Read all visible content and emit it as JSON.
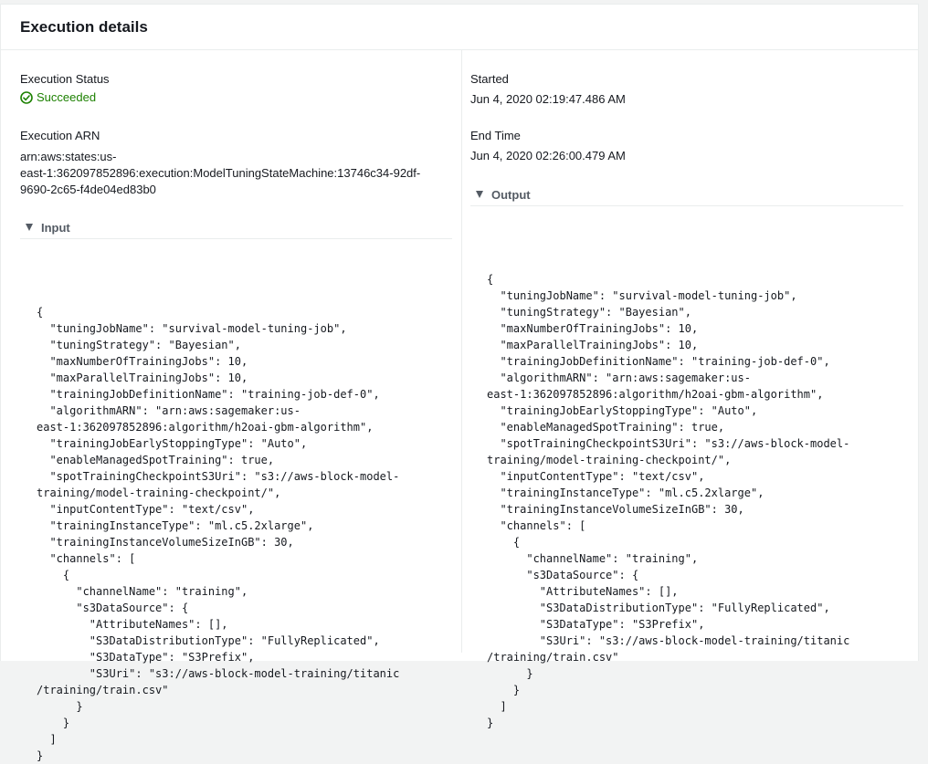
{
  "panel": {
    "title": "Execution details"
  },
  "left": {
    "status_label": "Execution Status",
    "status_value": "Succeeded",
    "arn_label": "Execution ARN",
    "arn_lines": [
      "arn:aws:states:us-",
      "east-1:362097852896:execution:ModelTuningStateMachine:13746c34-92df-",
      "9690-2c65-f4de04ed83b0"
    ],
    "input_label": "Input",
    "input_json": "{\n  \"tuningJobName\": \"survival-model-tuning-job\",\n  \"tuningStrategy\": \"Bayesian\",\n  \"maxNumberOfTrainingJobs\": 10,\n  \"maxParallelTrainingJobs\": 10,\n  \"trainingJobDefinitionName\": \"training-job-def-0\",\n  \"algorithmARN\": \"arn:aws:sagemaker:us-\neast-1:362097852896:algorithm/h2oai-gbm-algorithm\",\n  \"trainingJobEarlyStoppingType\": \"Auto\",\n  \"enableManagedSpotTraining\": true,\n  \"spotTrainingCheckpointS3Uri\": \"s3://aws-block-model-\ntraining/model-training-checkpoint/\",\n  \"inputContentType\": \"text/csv\",\n  \"trainingInstanceType\": \"ml.c5.2xlarge\",\n  \"trainingInstanceVolumeSizeInGB\": 30,\n  \"channels\": [\n    {\n      \"channelName\": \"training\",\n      \"s3DataSource\": {\n        \"AttributeNames\": [],\n        \"S3DataDistributionType\": \"FullyReplicated\",\n        \"S3DataType\": \"S3Prefix\",\n        \"S3Uri\": \"s3://aws-block-model-training/titanic\n/training/train.csv\"\n      }\n    }\n  ]\n}"
  },
  "right": {
    "started_label": "Started",
    "started_value": "Jun 4, 2020 02:19:47.486 AM",
    "end_label": "End Time",
    "end_value": "Jun 4, 2020 02:26:00.479 AM",
    "output_label": "Output",
    "output_json": "{\n  \"tuningJobName\": \"survival-model-tuning-job\",\n  \"tuningStrategy\": \"Bayesian\",\n  \"maxNumberOfTrainingJobs\": 10,\n  \"maxParallelTrainingJobs\": 10,\n  \"trainingJobDefinitionName\": \"training-job-def-0\",\n  \"algorithmARN\": \"arn:aws:sagemaker:us-\neast-1:362097852896:algorithm/h2oai-gbm-algorithm\",\n  \"trainingJobEarlyStoppingType\": \"Auto\",\n  \"enableManagedSpotTraining\": true,\n  \"spotTrainingCheckpointS3Uri\": \"s3://aws-block-model-\ntraining/model-training-checkpoint/\",\n  \"inputContentType\": \"text/csv\",\n  \"trainingInstanceType\": \"ml.c5.2xlarge\",\n  \"trainingInstanceVolumeSizeInGB\": 30,\n  \"channels\": [\n    {\n      \"channelName\": \"training\",\n      \"s3DataSource\": {\n        \"AttributeNames\": [],\n        \"S3DataDistributionType\": \"FullyReplicated\",\n        \"S3DataType\": \"S3Prefix\",\n        \"S3Uri\": \"s3://aws-block-model-training/titanic\n/training/train.csv\"\n      }\n    }\n  ]\n}"
  },
  "icons": {
    "status": "check-circle-icon",
    "input_toggle": "caret-down-icon",
    "output_toggle": "caret-down-icon"
  },
  "colors": {
    "success": "#1d8102",
    "text": "#16191f",
    "muted": "#545b64",
    "border": "#eaeded"
  }
}
